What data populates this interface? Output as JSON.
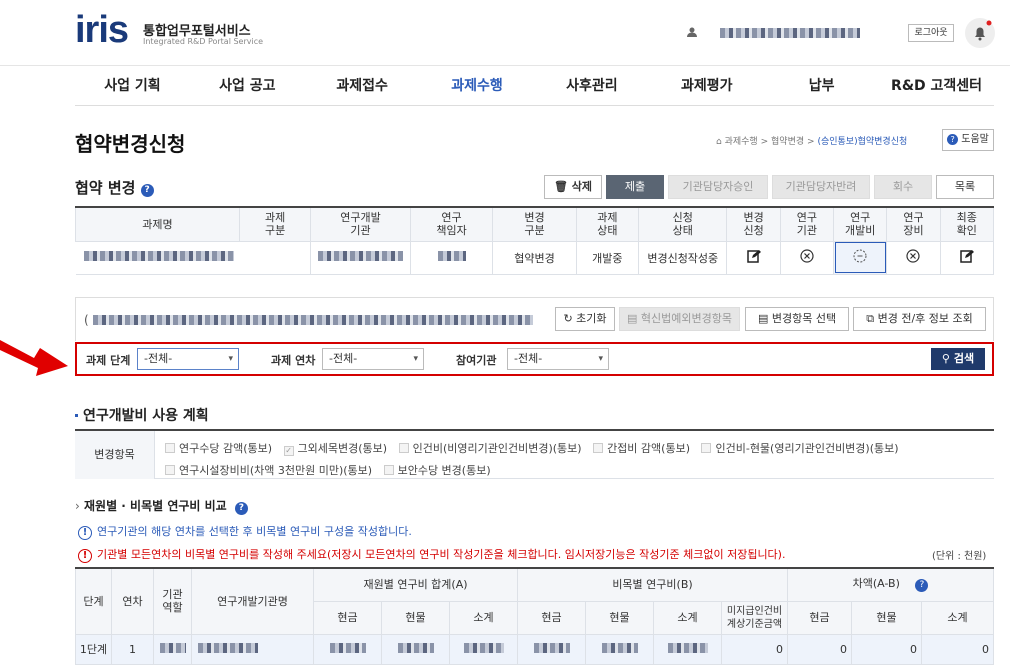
{
  "header": {
    "logo": "iris",
    "service_name": "통합업무포털서비스",
    "service_sub": "Integrated R&D Portal Service",
    "logout": "로그아웃"
  },
  "gnb": [
    "사업 기획",
    "사업 공고",
    "과제접수",
    "과제수행",
    "사후관리",
    "과제평가",
    "납부",
    "R&D 고객센터"
  ],
  "page": {
    "title": "협약변경신청",
    "breadcrumb": [
      "과제수행",
      ">",
      "협약변경",
      ">",
      "(승인통보)협약변경신청"
    ],
    "help": "도움말"
  },
  "section": {
    "title": "협약 변경"
  },
  "actions": {
    "delete": "삭제",
    "submit": "제출",
    "approve": "기관담당자승인",
    "reject": "기관담당자반려",
    "recall": "회수",
    "list": "목록"
  },
  "table1": {
    "headers": [
      "과제명",
      "과제\n구분",
      "연구개발\n기관",
      "연구\n책임자",
      "변경\n구분",
      "과제\n상태",
      "신청\n상태",
      "변경\n신청",
      "연구\n기관",
      "연구\n개발비",
      "연구\n장비",
      "최종\n확인"
    ],
    "row": {
      "change_type": "협약변경",
      "task_status": "개발중",
      "apply_status": "변경신청작성중"
    }
  },
  "toolbar": {
    "reset": "초기화",
    "innov": "혁신법예외변경항목",
    "select": "변경항목 선택",
    "compare": "변경 전/후 정보 조회"
  },
  "filter": {
    "stage_label": "과제 단계",
    "stage_value": "-전체-",
    "year_label": "과제 연차",
    "year_value": "-전체-",
    "org_label": "참여기관",
    "org_value": "-전체-",
    "search": "검색"
  },
  "plan": {
    "title": "연구개발비 사용 계획",
    "change_label": "변경항목",
    "items": [
      "연구수당 감액(통보)",
      "그외세목변경(통보)",
      "인건비(비영리기관인건비변경)(통보)",
      "간접비 감액(통보)",
      "인건비-현물(영리기관인건비변경)(통보)",
      "연구시설장비비(차액 3천만원 미만)(통보)",
      "보안수당 변경(통보)"
    ]
  },
  "compare": {
    "title": "재원별 · 비목별 연구비 비교",
    "info1": "연구기관의 해당 연차를 선택한 후 비목별 연구비 구성을 작성합니다.",
    "info2": "기관별 모든연차의 비목별 연구비를 작성해 주세요(저장시 모든연차의 연구비 작성기준을 체크합니다. 임시저장기능은 작성기준 체크없이 저장됩니다).",
    "unit": "(단위 : 천원)"
  },
  "table3": {
    "h_stage": "단계",
    "h_year": "연차",
    "h_role": "기관\n역할",
    "h_org": "연구개발기관명",
    "h_a": "재원별 연구비 합계(A)",
    "h_b": "비목별 연구비(B)",
    "h_diff": "차액(A-B)",
    "sub": [
      "현금",
      "현물",
      "소계",
      "현금",
      "현물",
      "소계",
      "미지급인건비\n계상기준금액",
      "현금",
      "현물",
      "소계"
    ],
    "row": {
      "stage": "1단계",
      "year": "1",
      "v1": "0",
      "v2": "0",
      "v3": "0",
      "v4": "0"
    }
  }
}
